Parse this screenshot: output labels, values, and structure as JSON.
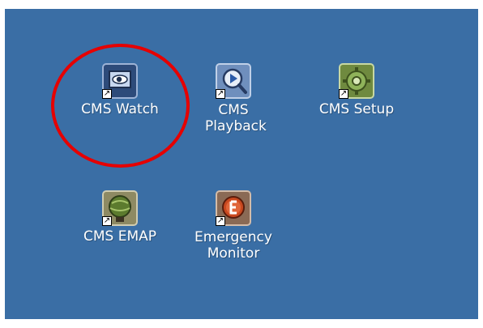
{
  "desktop": {
    "background": "#3a6ea5",
    "icons": [
      {
        "label": "CMS Watch",
        "icon": "cms-watch-icon"
      },
      {
        "label": "CMS Playback",
        "icon": "cms-playback-icon"
      },
      {
        "label": "CMS Setup",
        "icon": "cms-setup-icon"
      },
      {
        "label": "CMS EMAP",
        "icon": "cms-emap-icon"
      },
      {
        "label": "Emergency Monitor",
        "icon": "emergency-monitor-icon"
      }
    ]
  },
  "annotation": {
    "highlight_color": "#e60000",
    "highlighted_item": "CMS Watch"
  },
  "shortcut_glyph": "↗"
}
